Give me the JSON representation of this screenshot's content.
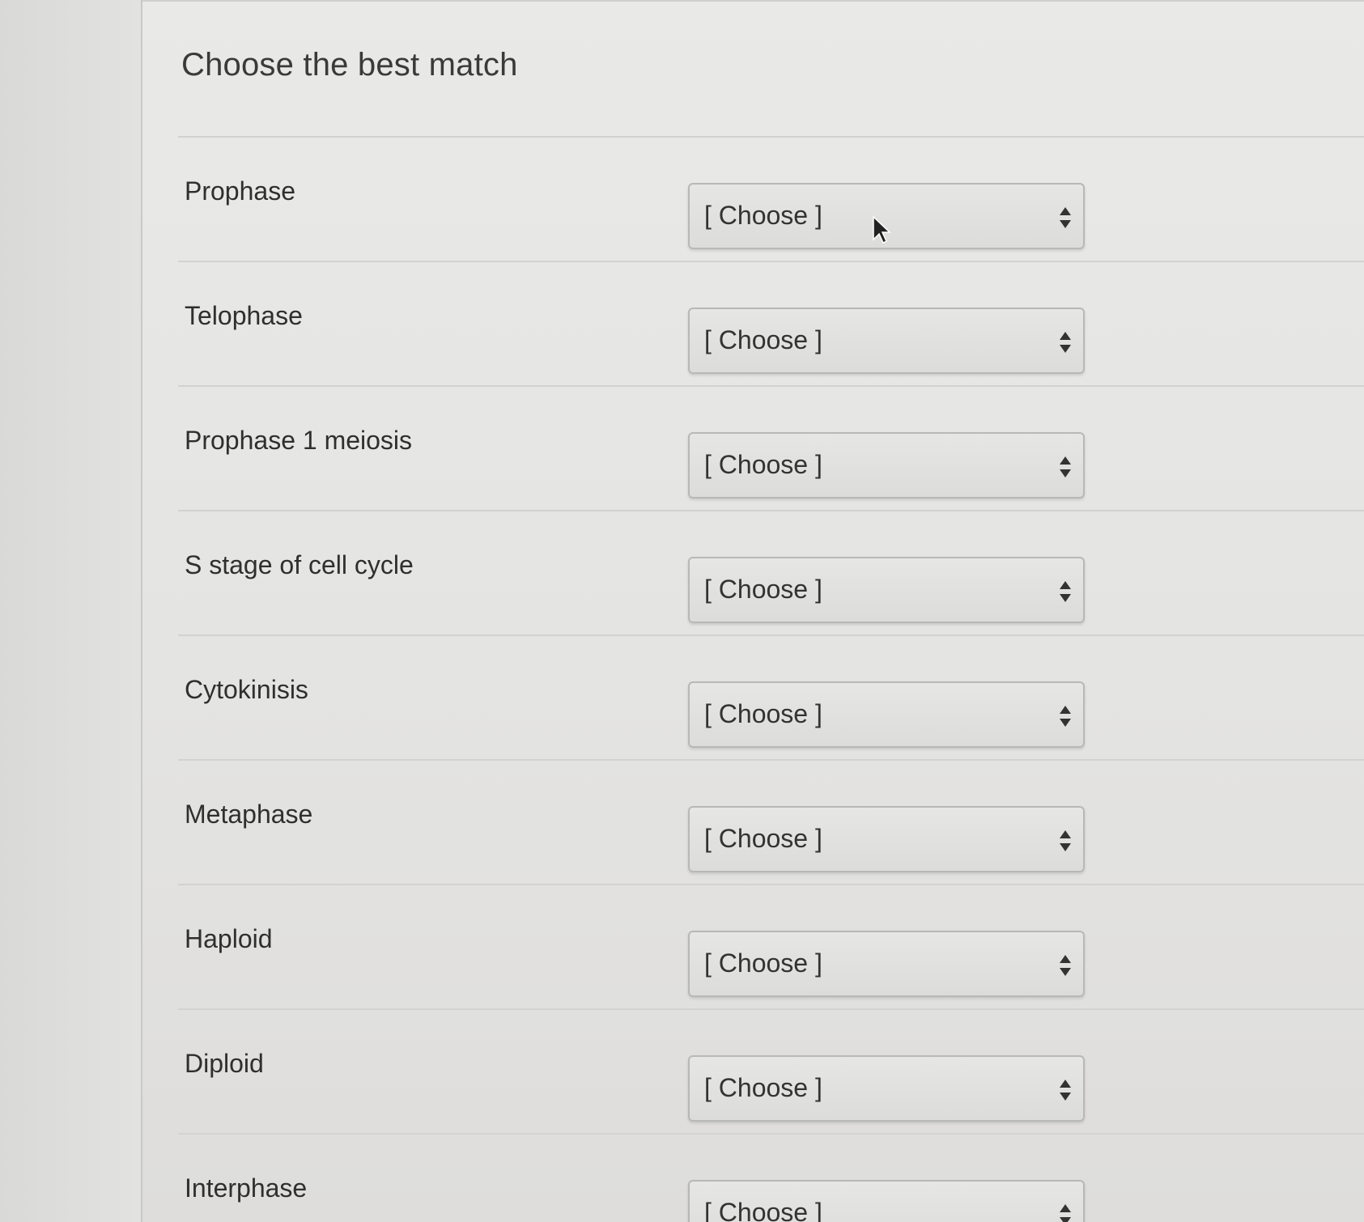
{
  "question": {
    "title": "Choose the best match"
  },
  "matches": [
    {
      "term": "Prophase",
      "selected": "[ Choose ]"
    },
    {
      "term": "Telophase",
      "selected": "[ Choose ]"
    },
    {
      "term": "Prophase 1 meiosis",
      "selected": "[ Choose ]"
    },
    {
      "term": "S stage of cell cycle",
      "selected": "[ Choose ]"
    },
    {
      "term": "Cytokinisis",
      "selected": "[ Choose ]"
    },
    {
      "term": "Metaphase",
      "selected": "[ Choose ]"
    },
    {
      "term": "Haploid",
      "selected": "[ Choose ]"
    },
    {
      "term": "Diploid",
      "selected": "[ Choose ]"
    },
    {
      "term": "Interphase",
      "selected": "[ Choose ]"
    }
  ],
  "icons": {
    "dropdown": "sort-arrows-icon",
    "pointer": "mouse-cursor-icon"
  },
  "colors": {
    "background": "#e6e6e4",
    "text": "#2f2f2f",
    "select_border": "#b8b8b6",
    "divider": "#d2d2d0"
  }
}
